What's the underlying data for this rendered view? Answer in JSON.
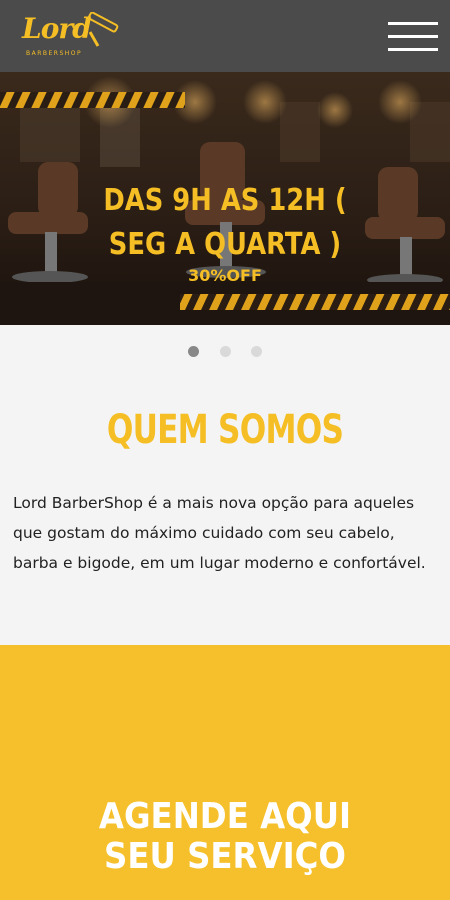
{
  "header": {
    "logo_text": "Lord",
    "logo_sub": "BARBERSHOP",
    "menu_icon": "hamburger-menu-icon"
  },
  "hero": {
    "title_line1": "DAS 9H AS 12H (",
    "title_line2": "SEG A QUARTA )",
    "subtitle": "30%OFF",
    "slides": 3,
    "active_slide": 0
  },
  "about": {
    "title": "QUEM SOMOS",
    "text": "Lord BarberShop é a mais nova opção para aqueles que gostam do máximo cuidado com seu cabelo, barba e bigode, em um lugar moderno e confortável."
  },
  "cta": {
    "line1": "AGENDE AQUI",
    "line2": "SEU SERVIÇO"
  },
  "colors": {
    "header_bg": "#4b4b4b",
    "accent": "#f5be25",
    "cta_bg": "#f5c02c",
    "page_bg": "#f4f4f4"
  }
}
